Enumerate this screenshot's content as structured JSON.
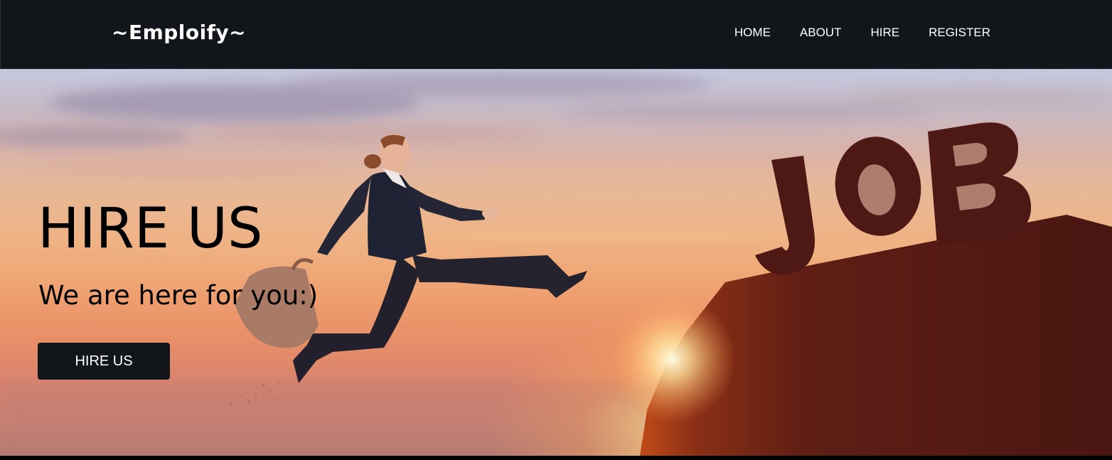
{
  "navbar": {
    "brand": "~Emploify~",
    "links": [
      "HOME",
      "ABOUT",
      "HIRE",
      "REGISTER"
    ]
  },
  "hero": {
    "title": "HIRE US",
    "subtitle": "We are here for you:)",
    "button_label": "HIRE US",
    "background_image": {
      "description_icon": "jumping-businesswoman-sunset-job-sign",
      "sign_text": "JOB"
    }
  },
  "colors": {
    "navbar_bg": "#12161a",
    "button_bg": "#12161a",
    "text_light": "#ffffff",
    "text_dark": "#000000"
  }
}
